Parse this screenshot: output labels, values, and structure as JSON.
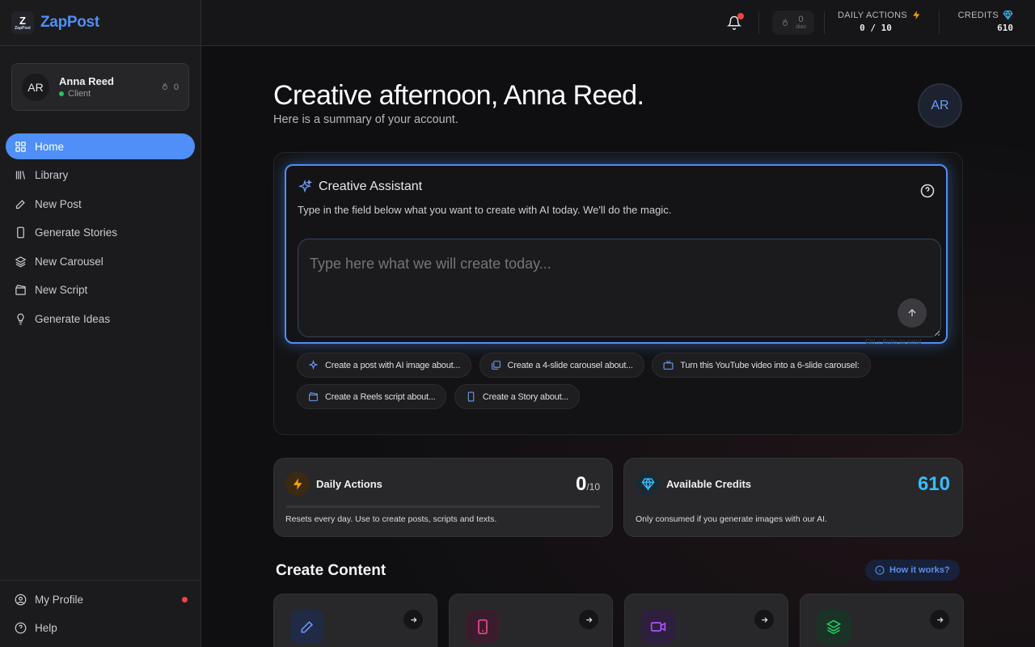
{
  "brand": {
    "name": "ZapPost",
    "logo_top": "Z",
    "logo_text": "ZapPost"
  },
  "user": {
    "initials": "AR",
    "name": "Anna Reed",
    "role": "Client",
    "streak": "0"
  },
  "nav": {
    "items": [
      {
        "label": "Home",
        "icon": "grid-icon"
      },
      {
        "label": "Library",
        "icon": "library-icon"
      },
      {
        "label": "New Post",
        "icon": "pencil-icon"
      },
      {
        "label": "Generate Stories",
        "icon": "phone-icon"
      },
      {
        "label": "New Carousel",
        "icon": "layers-icon"
      },
      {
        "label": "New Script",
        "icon": "clapperboard-icon"
      },
      {
        "label": "Generate Ideas",
        "icon": "lightbulb-icon"
      }
    ],
    "bottom": [
      {
        "label": "My Profile",
        "icon": "user-circle-icon"
      },
      {
        "label": "Help",
        "icon": "help-circle-icon"
      }
    ]
  },
  "topbar": {
    "streak_value": "0",
    "streak_label": "dias",
    "daily_label": "DAILY ACTIONS",
    "daily_value": "0 / 10",
    "credits_label": "CREDITS",
    "credits_value": "610"
  },
  "greeting": {
    "title": "Creative afternoon, Anna Reed.",
    "subtitle": "Here is a summary of your account.",
    "avatar": "AR"
  },
  "assistant": {
    "title": "Creative Assistant",
    "subtitle": "Type in the field below what you want to create with AI today. We'll do the magic.",
    "placeholder": "Type here what we will create today...",
    "hint": "Ctrl + Enter to send",
    "chips": [
      {
        "label": "Create a post with AI image about...",
        "icon": "sparkle-icon"
      },
      {
        "label": "Create a 4-slide carousel about...",
        "icon": "images-icon"
      },
      {
        "label": "Turn this YouTube video into a 6-slide carousel:",
        "icon": "tv-icon"
      },
      {
        "label": "Create a Reels script about...",
        "icon": "clapperboard-icon"
      },
      {
        "label": "Create a Story about...",
        "icon": "phone-icon"
      }
    ]
  },
  "daily_card": {
    "title": "Daily Actions",
    "value": "0",
    "max": "/10",
    "progress": 0,
    "desc": "Resets every day. Use to create posts, scripts and texts."
  },
  "credits_card": {
    "title": "Available Credits",
    "value": "610",
    "desc": "Only consumed if you generate images with our AI."
  },
  "create_section": {
    "title": "Create Content",
    "how_label": "How it works?",
    "cards": [
      {
        "icon": "pencil-icon",
        "color": "#6b8ef5"
      },
      {
        "icon": "phone-icon",
        "color": "#ec4899"
      },
      {
        "icon": "video-icon",
        "color": "#a855f7"
      },
      {
        "icon": "layers-icon",
        "color": "#22c55e"
      }
    ]
  },
  "colors": {
    "accent": "#4f8ff7",
    "amber": "#f59e0b",
    "credits": "#38bdf8"
  }
}
